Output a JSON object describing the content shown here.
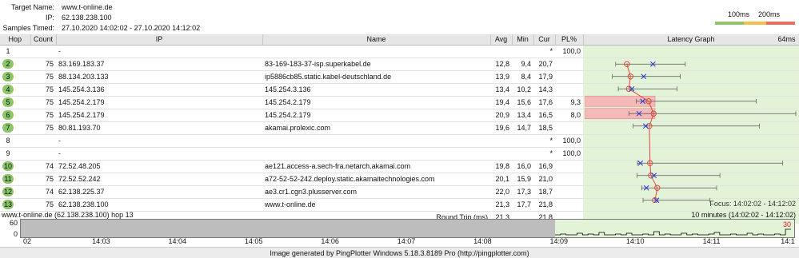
{
  "header": {
    "target_name_label": "Target Name:",
    "target_name": "www.t-online.de",
    "ip_label": "IP:",
    "ip": "62.138.238.100",
    "samples_label": "Samples Timed:",
    "samples_range": "27.10.2020 14:02:02 - 27.10.2020 14:12:02"
  },
  "scale": {
    "label_100": "100ms",
    "label_200": "200ms",
    "colors": [
      "#8cc56a",
      "#f5c04a",
      "#ef6c5a"
    ]
  },
  "columns": {
    "hop": "Hop",
    "count": "Count",
    "ip": "IP",
    "name": "Name",
    "avg": "Avg",
    "min": "Min",
    "cur": "Cur",
    "pl": "PL%",
    "graph": "Latency Graph",
    "graph_max": "64ms"
  },
  "hops": [
    {
      "hop": "1",
      "count": "",
      "ip": "-",
      "name": "",
      "avg": "",
      "min": "",
      "cur": "*",
      "pl": "100,0",
      "active": false
    },
    {
      "hop": "2",
      "count": "75",
      "ip": "83.169.183.37",
      "name": "83-169-183-37-isp.superkabel.de",
      "avg": "12,8",
      "min": "9,4",
      "cur": "20,7",
      "pl": "",
      "active": true
    },
    {
      "hop": "3",
      "count": "75",
      "ip": "88.134.203.133",
      "name": "ip5886cb85.static.kabel-deutschland.de",
      "avg": "13,9",
      "min": "8,4",
      "cur": "17,9",
      "pl": "",
      "active": true
    },
    {
      "hop": "4",
      "count": "75",
      "ip": "145.254.3.136",
      "name": "145.254.3.136",
      "avg": "13,4",
      "min": "10,2",
      "cur": "14,3",
      "pl": "",
      "active": true
    },
    {
      "hop": "5",
      "count": "75",
      "ip": "145.254.2.179",
      "name": "145.254.2.179",
      "avg": "19,4",
      "min": "15,6",
      "cur": "17,6",
      "pl": "9,3",
      "active": true
    },
    {
      "hop": "6",
      "count": "75",
      "ip": "145.254.2.179",
      "name": "145.254.2.179",
      "avg": "20,9",
      "min": "13,4",
      "cur": "16,5",
      "pl": "8,0",
      "active": true
    },
    {
      "hop": "7",
      "count": "75",
      "ip": "80.81.193.70",
      "name": "akamai.prolexic.com",
      "avg": "19,6",
      "min": "14,7",
      "cur": "18,5",
      "pl": "",
      "active": true
    },
    {
      "hop": "8",
      "count": "",
      "ip": "-",
      "name": "",
      "avg": "",
      "min": "",
      "cur": "*",
      "pl": "100,0",
      "active": false
    },
    {
      "hop": "9",
      "count": "",
      "ip": "-",
      "name": "",
      "avg": "",
      "min": "",
      "cur": "*",
      "pl": "100,0",
      "active": false
    },
    {
      "hop": "10",
      "count": "74",
      "ip": "72.52.48.205",
      "name": "ae121.access-a.sech-fra.netarch.akamai.com",
      "avg": "19,8",
      "min": "16,0",
      "cur": "16,9",
      "pl": "",
      "active": true
    },
    {
      "hop": "11",
      "count": "75",
      "ip": "72.52.52.242",
      "name": "a72-52-52-242.deploy.static.akamaitechnologies.com",
      "avg": "20,1",
      "min": "15,9",
      "cur": "21,0",
      "pl": "",
      "active": true
    },
    {
      "hop": "12",
      "count": "74",
      "ip": "62.138.225.37",
      "name": "ae3.cr1.cgn3.plusserver.com",
      "avg": "22,0",
      "min": "17,3",
      "cur": "18,7",
      "pl": "",
      "active": true
    },
    {
      "hop": "13",
      "count": "75",
      "ip": "62.138.238.100",
      "name": "www.t-online.de",
      "avg": "21,3",
      "min": "17,7",
      "cur": "21,8",
      "pl": "",
      "active": true
    }
  ],
  "round_trip": {
    "label": "Round Trip (ms)",
    "avg": "21,3",
    "cur": "21,8"
  },
  "graph_data": {
    "max_ms": 64,
    "hops": [
      {
        "hop": 2,
        "avg": 12.8,
        "cur": 20.7,
        "min": 9.4,
        "max": 30.5
      },
      {
        "hop": 3,
        "avg": 13.9,
        "cur": 17.9,
        "min": 8.4,
        "max": 29.0
      },
      {
        "hop": 4,
        "avg": 13.4,
        "cur": 14.3,
        "min": 10.2,
        "max": 28.0
      },
      {
        "hop": 5,
        "avg": 19.4,
        "cur": 17.6,
        "min": 15.6,
        "max": 52.0,
        "pl": 9.3
      },
      {
        "hop": 6,
        "avg": 20.9,
        "cur": 16.5,
        "min": 13.4,
        "max": 64.0,
        "pl": 8.0
      },
      {
        "hop": 7,
        "avg": 19.6,
        "cur": 18.5,
        "min": 14.7,
        "max": 53.0
      },
      {
        "hop": 10,
        "avg": 19.8,
        "cur": 16.9,
        "min": 16.0,
        "max": 60.0
      },
      {
        "hop": 11,
        "avg": 20.1,
        "cur": 21.0,
        "min": 15.9,
        "max": 41.0
      },
      {
        "hop": 12,
        "avg": 22.0,
        "cur": 18.7,
        "min": 17.3,
        "max": 40.0
      },
      {
        "hop": 13,
        "avg": 21.3,
        "cur": 21.8,
        "min": 17.7,
        "max": 38.0
      }
    ]
  },
  "focus": "Focus: 14:02:02 - 14:12:02",
  "timeline": {
    "title": "www.t-online.de (62.138.238.100) hop 13",
    "range": "10 minutes (14:02:02 - 14:12:02)",
    "y_top": "60",
    "y_bottom": "0",
    "peak_label": "30",
    "ticks": [
      "02",
      "14:03",
      "14:04",
      "14:05",
      "14:06",
      "14:07",
      "14:08",
      "14:09",
      "14:10",
      "14:11",
      "14:1"
    ],
    "focus_start_label": "14:09"
  },
  "footer": "Image generated by PingPlotter Windows 5.18.3.8189 Pro (http://pingplotter.com)"
}
